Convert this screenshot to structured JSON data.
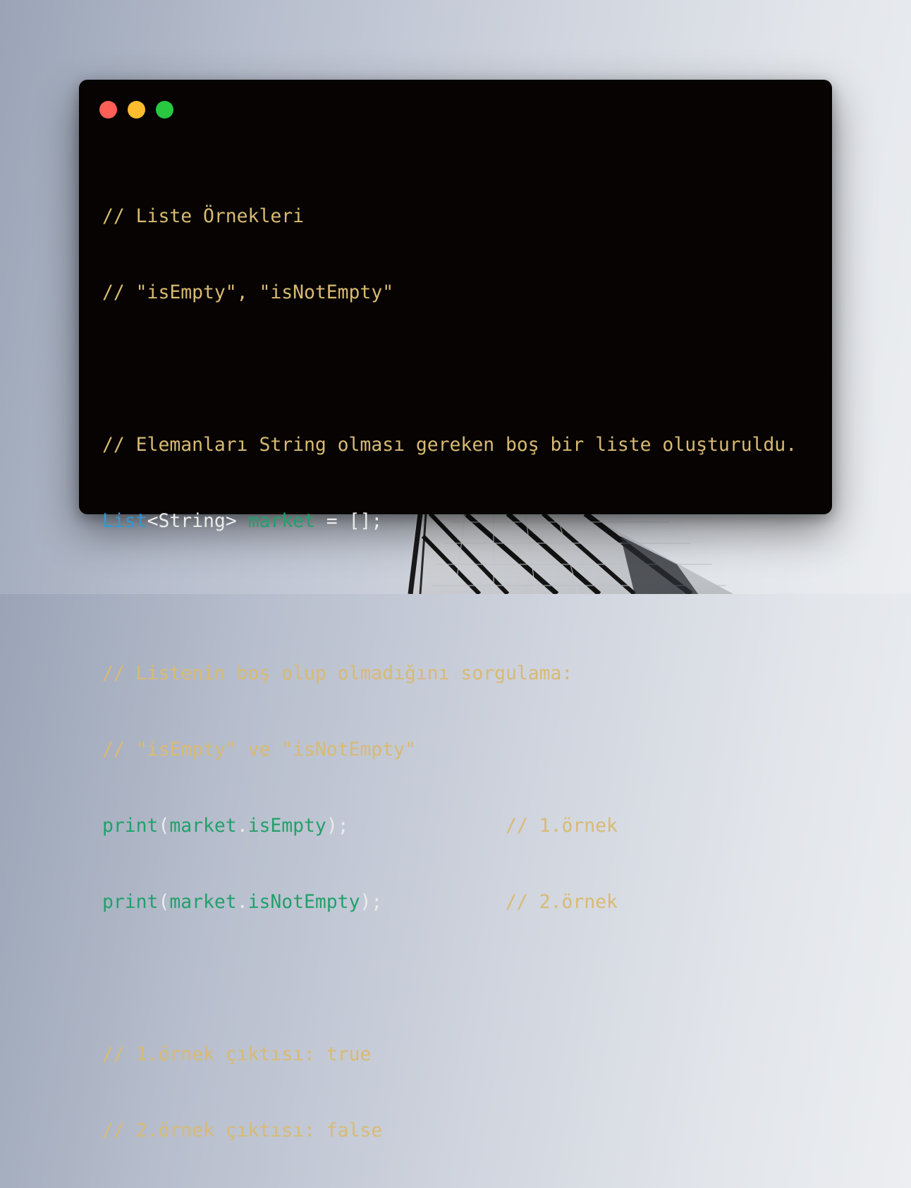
{
  "colors": {
    "dot_close": "#ff5f57",
    "dot_minimize": "#febc2e",
    "dot_zoom": "#28c840",
    "comment": "#d9ba72",
    "type": "#2d9ad8",
    "identifier": "#22a06b",
    "plain": "#ececec",
    "window_background": "#060302"
  },
  "window": {
    "controls": [
      "close-dot",
      "minimize-dot",
      "zoom-dot"
    ]
  },
  "code": {
    "line1": {
      "comment": "// Liste Örnekleri"
    },
    "line2": {
      "comment": "// \"isEmpty\", \"isNotEmpty\""
    },
    "line3": {
      "comment": "// Elemanları String olması gereken boş bir liste oluşturuldu."
    },
    "line4": {
      "type": "List",
      "generic": "<String> ",
      "ident": "market",
      "rest": " = [];"
    },
    "line5": {
      "comment": "// Listenin boş olup olmadığını sorgulama:"
    },
    "line6": {
      "comment": "// \"isEmpty\" ve \"isNotEmpty\""
    },
    "line7": {
      "fn": "print",
      "open": "(",
      "obj": "market",
      "dot": ".",
      "prop": "isEmpty",
      "close": ");",
      "pad": "              ",
      "comment": "// 1.örnek"
    },
    "line8": {
      "fn": "print",
      "open": "(",
      "obj": "market",
      "dot": ".",
      "prop": "isNotEmpty",
      "close": ");",
      "pad": "           ",
      "comment": "// 2.örnek"
    },
    "line9": {
      "comment": "// 1.örnek çıktısı: true"
    },
    "line10": {
      "comment": "// 2.örnek çıktısı: false"
    }
  }
}
